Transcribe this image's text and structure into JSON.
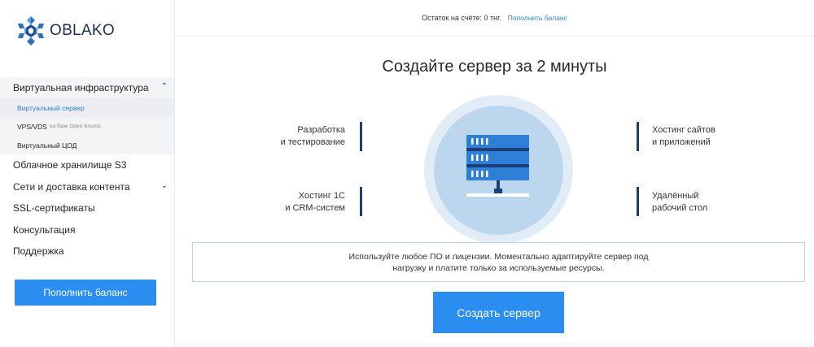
{
  "brand": {
    "name": "OBLAKO",
    "logo_icon": "snowflake-logo-icon"
  },
  "sidebar": {
    "group": {
      "label": "Виртуальная инфраструктура",
      "icon": "chevron-up-icon",
      "items": [
        {
          "label": "Виртуальный сервер",
          "note": ""
        },
        {
          "label": "VPS/VDS",
          "note": "на базе Open Source"
        },
        {
          "label": "Виртуальный ЦОД",
          "note": ""
        }
      ]
    },
    "items": [
      {
        "label": "Облачное хранилище S3"
      },
      {
        "label": "Сети и доставка контента",
        "icon": "chevron-down-icon"
      },
      {
        "label": "SSL-сертификаты"
      },
      {
        "label": "Консультация"
      },
      {
        "label": "Поддержка"
      }
    ],
    "topup_label": "Пополнить баланс"
  },
  "topbar": {
    "balance_text": "Остаток на счёте: 0 тнг.",
    "topup_link": "Пополнить баланс"
  },
  "main": {
    "headline": "Создайте сервер за 2 минуты",
    "features": {
      "top_left": [
        "Разработка",
        "и тестирование"
      ],
      "bottom_left": [
        "Хостинг 1С",
        "и CRM-систем"
      ],
      "top_right": [
        "Хостинг сайтов",
        "и приложений"
      ],
      "bottom_right": [
        "Удалённый",
        "рабочий стол"
      ]
    },
    "illustration_icon": "server-network-icon",
    "notice": [
      "Используйте любое ПО и лицензии. Моментально адаптируйте сервер под",
      "нагрузку и платите только за используемые ресурсы."
    ],
    "create_label": "Создать сервер"
  },
  "colors": {
    "accent": "#2a8ef0",
    "link": "#2d7fd3",
    "dark_bar": "#1e3d73",
    "circle_light": "#e2ecf6",
    "circle": "#bcd6ee"
  }
}
